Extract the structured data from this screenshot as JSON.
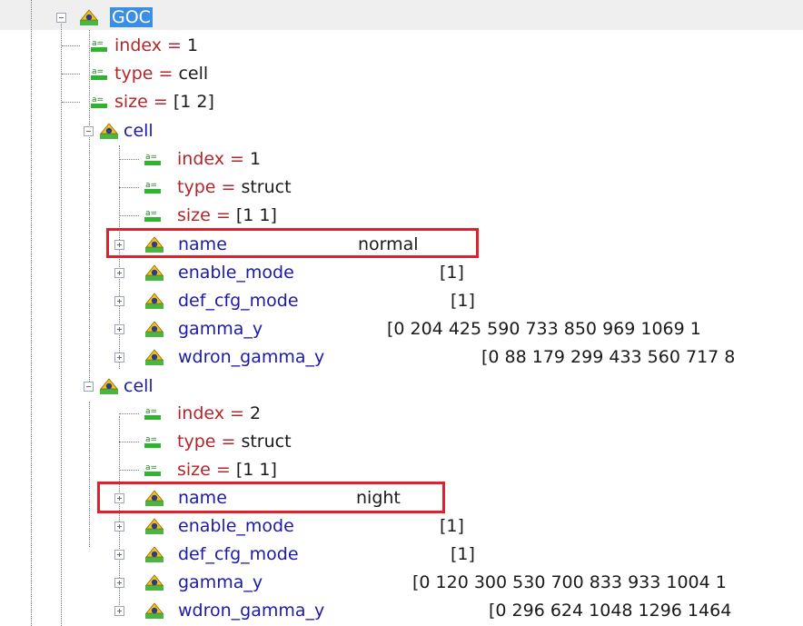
{
  "root": {
    "label": "GOC"
  },
  "root_attrs": [
    {
      "key": "index",
      "value": "1"
    },
    {
      "key": "type",
      "value": "cell"
    },
    {
      "key": "size",
      "value": "[1 2]"
    }
  ],
  "cells": [
    {
      "label": "cell",
      "attrs": [
        {
          "key": "index",
          "value": "1"
        },
        {
          "key": "type",
          "value": "struct"
        },
        {
          "key": "size",
          "value": "[1 1]"
        }
      ],
      "children": [
        {
          "label": "name",
          "value": "normal"
        },
        {
          "label": "enable_mode",
          "value": "[1]"
        },
        {
          "label": "def_cfg_mode",
          "value": "[1]"
        },
        {
          "label": "gamma_y",
          "value": "[0 204 425 590 733 850 969 1069 1"
        },
        {
          "label": "wdron_gamma_y",
          "value": "[0 88 179 299 433 560 717 8"
        }
      ]
    },
    {
      "label": "cell",
      "attrs": [
        {
          "key": "index",
          "value": "2"
        },
        {
          "key": "type",
          "value": "struct"
        },
        {
          "key": "size",
          "value": "[1 1]"
        }
      ],
      "children": [
        {
          "label": "name",
          "value": "night"
        },
        {
          "label": "enable_mode",
          "value": "[1]"
        },
        {
          "label": "def_cfg_mode",
          "value": "[1]"
        },
        {
          "label": "gamma_y",
          "value": "[0 120 300 530 700 833 933 1004 1"
        },
        {
          "label": "wdron_gamma_y",
          "value": "[0 296 624 1048 1296 1464"
        }
      ]
    }
  ],
  "colors": {
    "element_name": "#1c1aa6",
    "attribute_name": "#b3262b",
    "highlight_box": "#e0202a",
    "selection": "#3a8ee6"
  }
}
